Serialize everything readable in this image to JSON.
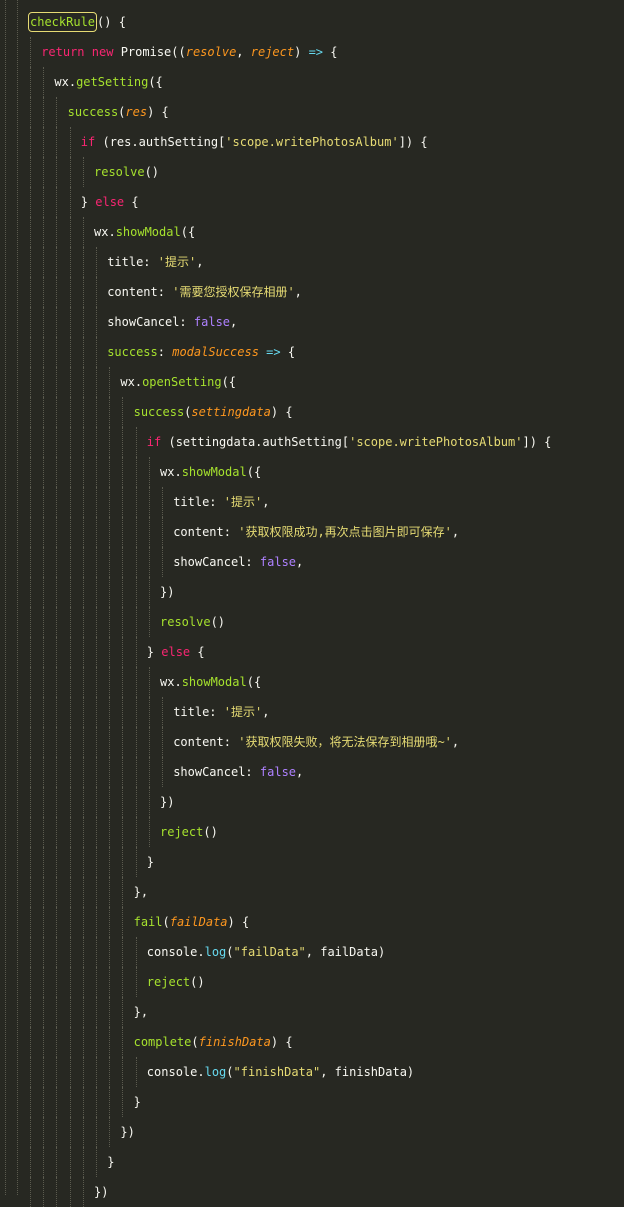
{
  "editor": {
    "lines": [
      {
        "indent": 0,
        "tokens": [
          {
            "t": "checkRule",
            "c": "fn",
            "hl": true
          },
          {
            "t": "() {",
            "c": "plain"
          }
        ]
      },
      {
        "indent": 1,
        "tokens": [
          {
            "t": "return",
            "c": "kw"
          },
          {
            "t": " ",
            "c": "plain"
          },
          {
            "t": "new",
            "c": "kw"
          },
          {
            "t": " Promise((",
            "c": "plain"
          },
          {
            "t": "resolve",
            "c": "param"
          },
          {
            "t": ", ",
            "c": "plain"
          },
          {
            "t": "reject",
            "c": "param"
          },
          {
            "t": ") ",
            "c": "plain"
          },
          {
            "t": "=>",
            "c": "op"
          },
          {
            "t": " {",
            "c": "plain"
          }
        ]
      },
      {
        "indent": 2,
        "tokens": [
          {
            "t": "wx.",
            "c": "plain"
          },
          {
            "t": "getSetting",
            "c": "fn"
          },
          {
            "t": "({",
            "c": "plain"
          }
        ]
      },
      {
        "indent": 3,
        "tokens": [
          {
            "t": "success",
            "c": "fn"
          },
          {
            "t": "(",
            "c": "plain"
          },
          {
            "t": "res",
            "c": "param"
          },
          {
            "t": ") {",
            "c": "plain"
          }
        ]
      },
      {
        "indent": 4,
        "tokens": [
          {
            "t": "if",
            "c": "kw"
          },
          {
            "t": " (res.authSetting[",
            "c": "plain"
          },
          {
            "t": "'scope.writePhotosAlbum'",
            "c": "str"
          },
          {
            "t": "]) {",
            "c": "plain"
          }
        ]
      },
      {
        "indent": 5,
        "tokens": [
          {
            "t": "resolve",
            "c": "fn"
          },
          {
            "t": "()",
            "c": "plain"
          }
        ]
      },
      {
        "indent": 4,
        "tokens": [
          {
            "t": "} ",
            "c": "plain"
          },
          {
            "t": "else",
            "c": "kw"
          },
          {
            "t": " {",
            "c": "plain"
          }
        ]
      },
      {
        "indent": 5,
        "tokens": [
          {
            "t": "wx.",
            "c": "plain"
          },
          {
            "t": "showModal",
            "c": "fn"
          },
          {
            "t": "({",
            "c": "plain"
          }
        ]
      },
      {
        "indent": 6,
        "tokens": [
          {
            "t": "title: ",
            "c": "plain"
          },
          {
            "t": "'提示'",
            "c": "str"
          },
          {
            "t": ",",
            "c": "plain"
          }
        ]
      },
      {
        "indent": 6,
        "tokens": [
          {
            "t": "content: ",
            "c": "plain"
          },
          {
            "t": "'需要您授权保存相册'",
            "c": "str"
          },
          {
            "t": ",",
            "c": "plain"
          }
        ]
      },
      {
        "indent": 6,
        "tokens": [
          {
            "t": "showCancel: ",
            "c": "plain"
          },
          {
            "t": "false",
            "c": "const"
          },
          {
            "t": ",",
            "c": "plain"
          }
        ]
      },
      {
        "indent": 6,
        "tokens": [
          {
            "t": "success",
            "c": "fn"
          },
          {
            "t": ": ",
            "c": "plain"
          },
          {
            "t": "modalSuccess",
            "c": "param"
          },
          {
            "t": " ",
            "c": "plain"
          },
          {
            "t": "=>",
            "c": "op"
          },
          {
            "t": " {",
            "c": "plain"
          }
        ]
      },
      {
        "indent": 7,
        "tokens": [
          {
            "t": "wx.",
            "c": "plain"
          },
          {
            "t": "openSetting",
            "c": "fn"
          },
          {
            "t": "({",
            "c": "plain"
          }
        ]
      },
      {
        "indent": 8,
        "tokens": [
          {
            "t": "success",
            "c": "fn"
          },
          {
            "t": "(",
            "c": "plain"
          },
          {
            "t": "settingdata",
            "c": "param"
          },
          {
            "t": ") {",
            "c": "plain"
          }
        ]
      },
      {
        "indent": 9,
        "tokens": [
          {
            "t": "if",
            "c": "kw"
          },
          {
            "t": " (settingdata.authSetting[",
            "c": "plain"
          },
          {
            "t": "'scope.writePhotosAlbum'",
            "c": "str"
          },
          {
            "t": "]) {",
            "c": "plain"
          }
        ]
      },
      {
        "indent": 10,
        "tokens": [
          {
            "t": "wx.",
            "c": "plain"
          },
          {
            "t": "showModal",
            "c": "fn"
          },
          {
            "t": "({",
            "c": "plain"
          }
        ]
      },
      {
        "indent": 11,
        "tokens": [
          {
            "t": "title: ",
            "c": "plain"
          },
          {
            "t": "'提示'",
            "c": "str"
          },
          {
            "t": ",",
            "c": "plain"
          }
        ]
      },
      {
        "indent": 11,
        "tokens": [
          {
            "t": "content: ",
            "c": "plain"
          },
          {
            "t": "'获取权限成功,再次点击图片即可保存'",
            "c": "str"
          },
          {
            "t": ",",
            "c": "plain"
          }
        ]
      },
      {
        "indent": 11,
        "tokens": [
          {
            "t": "showCancel: ",
            "c": "plain"
          },
          {
            "t": "false",
            "c": "const"
          },
          {
            "t": ",",
            "c": "plain"
          }
        ]
      },
      {
        "indent": 10,
        "tokens": [
          {
            "t": "})",
            "c": "plain"
          }
        ]
      },
      {
        "indent": 10,
        "tokens": [
          {
            "t": "resolve",
            "c": "fn"
          },
          {
            "t": "()",
            "c": "plain"
          }
        ]
      },
      {
        "indent": 9,
        "tokens": [
          {
            "t": "} ",
            "c": "plain"
          },
          {
            "t": "else",
            "c": "kw"
          },
          {
            "t": " {",
            "c": "plain"
          }
        ]
      },
      {
        "indent": 10,
        "tokens": [
          {
            "t": "wx.",
            "c": "plain"
          },
          {
            "t": "showModal",
            "c": "fn"
          },
          {
            "t": "({",
            "c": "plain"
          }
        ]
      },
      {
        "indent": 11,
        "tokens": [
          {
            "t": "title: ",
            "c": "plain"
          },
          {
            "t": "'提示'",
            "c": "str"
          },
          {
            "t": ",",
            "c": "plain"
          }
        ]
      },
      {
        "indent": 11,
        "tokens": [
          {
            "t": "content: ",
            "c": "plain"
          },
          {
            "t": "'获取权限失败，将无法保存到相册哦~'",
            "c": "str"
          },
          {
            "t": ",",
            "c": "plain"
          }
        ]
      },
      {
        "indent": 11,
        "tokens": [
          {
            "t": "showCancel: ",
            "c": "plain"
          },
          {
            "t": "false",
            "c": "const"
          },
          {
            "t": ",",
            "c": "plain"
          }
        ]
      },
      {
        "indent": 10,
        "tokens": [
          {
            "t": "})",
            "c": "plain"
          }
        ]
      },
      {
        "indent": 10,
        "tokens": [
          {
            "t": "reject",
            "c": "fn"
          },
          {
            "t": "()",
            "c": "plain"
          }
        ]
      },
      {
        "indent": 9,
        "tokens": [
          {
            "t": "}",
            "c": "plain"
          }
        ]
      },
      {
        "indent": 8,
        "tokens": [
          {
            "t": "},",
            "c": "plain"
          }
        ]
      },
      {
        "indent": 8,
        "tokens": [
          {
            "t": "fail",
            "c": "fn"
          },
          {
            "t": "(",
            "c": "plain"
          },
          {
            "t": "failData",
            "c": "param"
          },
          {
            "t": ") {",
            "c": "plain"
          }
        ]
      },
      {
        "indent": 9,
        "tokens": [
          {
            "t": "console.",
            "c": "plain"
          },
          {
            "t": "log",
            "c": "op"
          },
          {
            "t": "(",
            "c": "plain"
          },
          {
            "t": "\"failData\"",
            "c": "str"
          },
          {
            "t": ", failData)",
            "c": "plain"
          }
        ]
      },
      {
        "indent": 9,
        "tokens": [
          {
            "t": "reject",
            "c": "fn"
          },
          {
            "t": "()",
            "c": "plain"
          }
        ]
      },
      {
        "indent": 8,
        "tokens": [
          {
            "t": "},",
            "c": "plain"
          }
        ]
      },
      {
        "indent": 8,
        "tokens": [
          {
            "t": "complete",
            "c": "fn"
          },
          {
            "t": "(",
            "c": "plain"
          },
          {
            "t": "finishData",
            "c": "param"
          },
          {
            "t": ") {",
            "c": "plain"
          }
        ]
      },
      {
        "indent": 9,
        "tokens": [
          {
            "t": "console.",
            "c": "plain"
          },
          {
            "t": "log",
            "c": "op"
          },
          {
            "t": "(",
            "c": "plain"
          },
          {
            "t": "\"finishData\"",
            "c": "str"
          },
          {
            "t": ", finishData)",
            "c": "plain"
          }
        ]
      },
      {
        "indent": 8,
        "tokens": [
          {
            "t": "}",
            "c": "plain"
          }
        ]
      },
      {
        "indent": 7,
        "tokens": [
          {
            "t": "})",
            "c": "plain"
          }
        ]
      },
      {
        "indent": 6,
        "tokens": [
          {
            "t": "}",
            "c": "plain"
          }
        ]
      },
      {
        "indent": 5,
        "tokens": [
          {
            "t": "})",
            "c": "plain"
          }
        ]
      }
    ]
  }
}
